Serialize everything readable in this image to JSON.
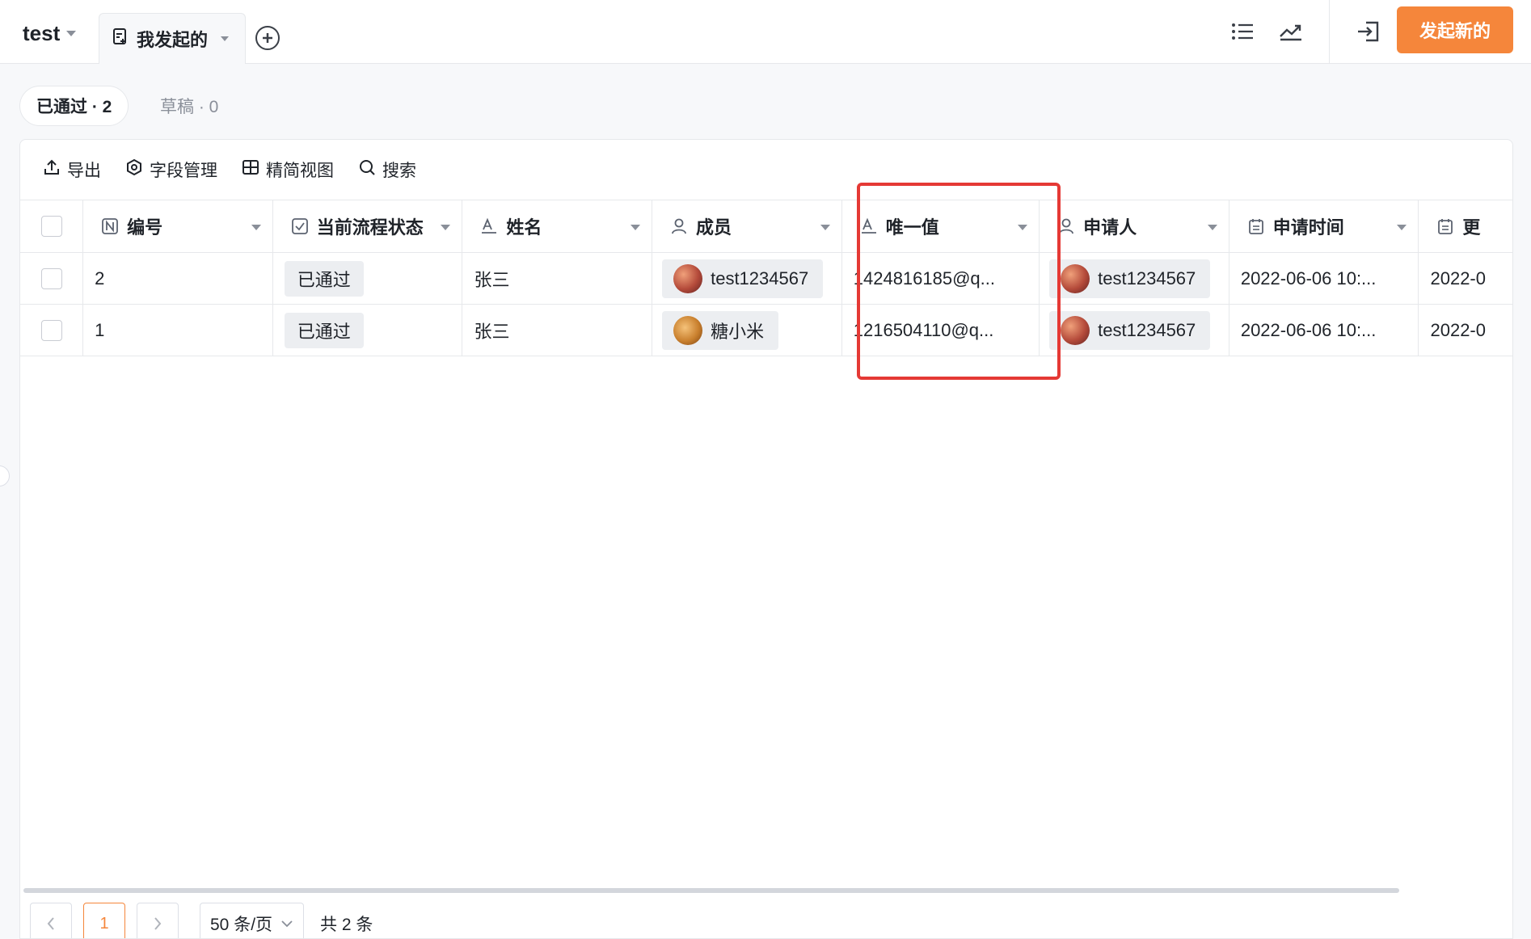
{
  "app": {
    "title": "test"
  },
  "tabs": [
    {
      "label": "我发起的"
    }
  ],
  "header_actions": {
    "primary_label": "发起新的"
  },
  "filters": {
    "approved": "已通过 · 2",
    "draft": "草稿 · 0"
  },
  "toolbar": {
    "export": "导出",
    "fields": "字段管理",
    "compact": "精简视图",
    "search": "搜索"
  },
  "columns": {
    "id": "编号",
    "status": "当前流程状态",
    "name": "姓名",
    "member": "成员",
    "unique": "唯一值",
    "applicant": "申请人",
    "apply_time": "申请时间",
    "update": "更"
  },
  "rows": [
    {
      "id": "2",
      "status": "已通过",
      "name": "张三",
      "member": "test1234567",
      "unique": "1424816185@q...",
      "applicant": "test1234567",
      "apply_time": "2022-06-06 10:...",
      "update": "2022-0"
    },
    {
      "id": "1",
      "status": "已通过",
      "name": "张三",
      "member": "糖小米",
      "unique": "1216504110@q...",
      "applicant": "test1234567",
      "apply_time": "2022-06-06 10:...",
      "update": "2022-0"
    }
  ],
  "pagination": {
    "current": "1",
    "page_size": "50 条/页",
    "total": "共 2 条"
  },
  "colors": {
    "accent": "#f5863b",
    "highlight": "#e53935"
  },
  "icons": [
    "caret-down-icon",
    "form-icon",
    "add-circle-icon",
    "list-view-icon",
    "trend-icon",
    "exit-icon",
    "export-icon",
    "settings-icon",
    "grid-icon",
    "search-icon",
    "number-field-icon",
    "checkbox-field-icon",
    "text-field-icon",
    "person-field-icon",
    "date-field-icon"
  ]
}
